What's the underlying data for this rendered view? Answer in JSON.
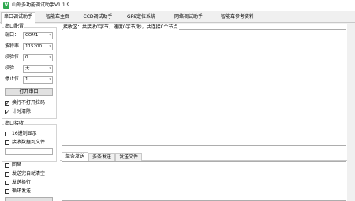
{
  "window": {
    "title": "山外多功能调试助手V1.1.9",
    "icon_letter": "V"
  },
  "tabs": [
    {
      "label": "串口调试助手",
      "active": true
    },
    {
      "label": "智能车主页",
      "active": false
    },
    {
      "label": "CCD调试助手",
      "active": false
    },
    {
      "label": "GPS定位系统",
      "active": false
    },
    {
      "label": "网络调试助手",
      "active": false
    },
    {
      "label": "智能车参考资料",
      "active": false
    }
  ],
  "serial_config": {
    "group_title": "串口配置",
    "port_label": "端口：",
    "port_value": "COM1",
    "baud_label": "波特率",
    "baud_value": "115200",
    "parity_label": "校验位",
    "parity_value": "0",
    "check_label": "校验",
    "check_value": "无",
    "stop_label": "停止位",
    "stop_value": "1",
    "open_button": "打开串口",
    "check_hex_display": "换行不打开拉码",
    "check_auto_clear": "计时清除"
  },
  "serial_receive": {
    "group_title": "串口接收",
    "hex_display": "16进制显示",
    "save_to_file": "接收数据到文件"
  },
  "serial_send": {
    "show": "回显",
    "send_auto_clear": "发送完自动清空",
    "send_newline": "发送换行",
    "timed_send": "循环发送"
  },
  "receive_area": {
    "title": "接收区：共接收0字节，速度0字节/秒，共连接0个节点"
  },
  "send_tabs": [
    {
      "label": "单条发送",
      "active": true
    },
    {
      "label": "多条发送",
      "active": false
    },
    {
      "label": "发送文件",
      "active": false
    }
  ]
}
